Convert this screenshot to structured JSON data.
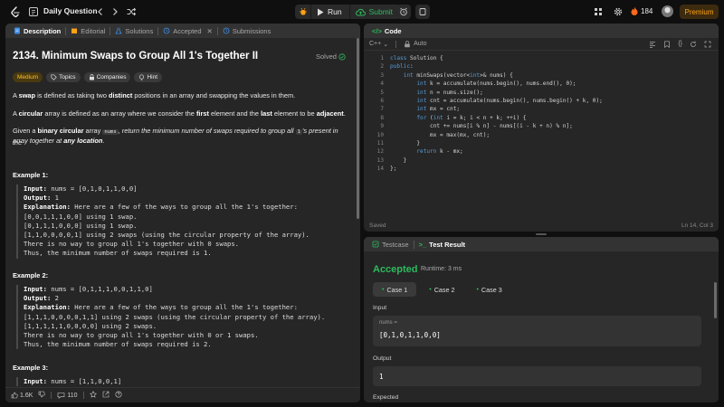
{
  "topbar": {
    "title": "Daily Question",
    "run_label": "Run",
    "submit_label": "Submit",
    "streak_count": "184",
    "premium_label": "Premium"
  },
  "left_tabs": [
    {
      "label": "Description"
    },
    {
      "label": "Editorial"
    },
    {
      "label": "Solutions"
    },
    {
      "label": "Accepted"
    },
    {
      "label": "Submissions"
    }
  ],
  "problem": {
    "title": "2134. Minimum Swaps to Group All 1's Together II",
    "status": "Solved",
    "chips": [
      "Medium",
      "Topics",
      "Companies",
      "Hint"
    ],
    "p1": [
      {
        "t": "A ",
        "b": false
      },
      {
        "t": "swap",
        "b": true
      },
      {
        "t": " is defined as taking two ",
        "b": false
      },
      {
        "t": "distinct",
        "b": true
      },
      {
        "t": " positions in an array and swapping the values in them.",
        "b": false
      }
    ],
    "p2": [
      {
        "t": "A ",
        "b": false
      },
      {
        "t": "circular",
        "b": true
      },
      {
        "t": " array is defined as an array where we consider the ",
        "b": false
      },
      {
        "t": "first",
        "b": true
      },
      {
        "t": " element and the ",
        "b": false
      },
      {
        "t": "last",
        "b": true
      },
      {
        "t": " element to be ",
        "b": false
      },
      {
        "t": "adjacent",
        "b": true
      },
      {
        "t": ".",
        "b": false
      }
    ],
    "p3_line1_a": "Given a ",
    "p3_line1_b": "binary circular",
    "p3_line1_c": " array ",
    "p3_code": "nums",
    "p3_line1_d": ", return the minimum number of swaps required to group all ",
    "p3_code2": "1",
    "p3_line1_e": "'s present in the",
    "p3_line2_a": "array together at ",
    "p3_line2_b": "any location",
    "p3_line2_c": "."
  },
  "examples": [
    {
      "title": "Example 1:",
      "input_label": "Input:",
      "input": "nums = [0,1,0,1,1,0,0]",
      "output_label": "Output:",
      "output": "1",
      "explanation_label": "Explanation:",
      "lines": [
        "Here are a few of the ways to group all the 1's together:",
        "[0,0,1,1,1,0,0] using 1 swap.",
        "[0,1,1,1,0,0,0] using 1 swap.",
        "[1,1,0,0,0,0,1] using 2 swaps (using the circular property of the array).",
        "There is no way to group all 1's together with 0 swaps.",
        "Thus, the minimum number of swaps required is 1."
      ]
    },
    {
      "title": "Example 2:",
      "input_label": "Input:",
      "input": "nums = [0,1,1,1,0,0,1,1,0]",
      "output_label": "Output:",
      "output": "2",
      "explanation_label": "Explanation:",
      "lines": [
        "Here are a few of the ways to group all the 1's together:",
        "[1,1,1,0,0,0,0,1,1] using 2 swaps (using the circular property of the array).",
        "[1,1,1,1,1,0,0,0,0] using 2 swaps.",
        "There is no way to group all 1's together with 0 or 1 swaps.",
        "Thus, the minimum number of swaps required is 2."
      ]
    },
    {
      "title": "Example 3:",
      "input_label": "Input:",
      "input": "nums = [1,1,0,0,1]"
    }
  ],
  "left_footer": {
    "likes": "1.6K",
    "comments": "110"
  },
  "code_panel": {
    "tab_label": "Code",
    "language": "C++",
    "mode": "Auto",
    "status": "Saved",
    "cursor": "Ln 14, Col 3",
    "lines": [
      "class Solution {",
      "public:",
      "    int minSwaps(vector<int>& nums) {",
      "        int k = accumulate(nums.begin(), nums.end(), 0);",
      "        int n = nums.size();",
      "        int cnt = accumulate(nums.begin(), nums.begin() + k, 0);",
      "        int mx = cnt;",
      "        for (int i = k; i < n + k; ++i) {",
      "            cnt += nums[i % n] - nums[(i - k + n) % n];",
      "            mx = max(mx, cnt);",
      "        }",
      "        return k - mx;",
      "    }",
      "};"
    ]
  },
  "test_panel": {
    "tab_testcase": "Testcase",
    "tab_result": "Test Result",
    "verdict": "Accepted",
    "runtime": "Runtime: 3 ms",
    "cases": [
      "Case 1",
      "Case 2",
      "Case 3"
    ],
    "input_label": "Input",
    "input_var": "nums =",
    "input_value": "[0,1,0,1,1,0,0]",
    "output_label": "Output",
    "output_value": "1",
    "expected_label": "Expected"
  },
  "colors": {
    "accent_orange": "#ffa116",
    "accepted_green": "#2cbb5d",
    "medium_yellow": "#ffc01e",
    "panel_bg": "#262626"
  }
}
